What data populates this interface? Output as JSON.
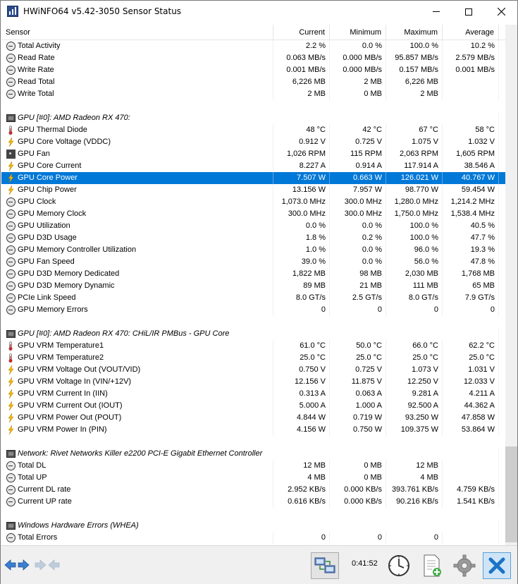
{
  "window": {
    "title": "HWiNFO64 v5.42-3050 Sensor Status"
  },
  "columns": {
    "sensor": "Sensor",
    "current": "Current",
    "minimum": "Minimum",
    "maximum": "Maximum",
    "average": "Average"
  },
  "rows": [
    {
      "type": "sensor",
      "icon": "clock-icon",
      "name": "Total Activity",
      "cur": "2.2 %",
      "min": "0.0 %",
      "max": "100.0 %",
      "avg": "10.2 %"
    },
    {
      "type": "sensor",
      "icon": "clock-icon",
      "name": "Read Rate",
      "cur": "0.063 MB/s",
      "min": "0.000 MB/s",
      "max": "95.857 MB/s",
      "avg": "2.579 MB/s"
    },
    {
      "type": "sensor",
      "icon": "clock-icon",
      "name": "Write Rate",
      "cur": "0.001 MB/s",
      "min": "0.000 MB/s",
      "max": "0.157 MB/s",
      "avg": "0.001 MB/s"
    },
    {
      "type": "sensor",
      "icon": "clock-icon",
      "name": "Read Total",
      "cur": "6,226 MB",
      "min": "2 MB",
      "max": "6,226 MB",
      "avg": ""
    },
    {
      "type": "sensor",
      "icon": "clock-icon",
      "name": "Write Total",
      "cur": "2 MB",
      "min": "0 MB",
      "max": "2 MB",
      "avg": ""
    },
    {
      "type": "blank"
    },
    {
      "type": "group",
      "icon": "chip-icon",
      "name": "GPU [#0]: AMD Radeon RX 470:"
    },
    {
      "type": "sensor",
      "icon": "thermometer-icon",
      "name": "GPU Thermal Diode",
      "cur": "48 °C",
      "min": "42 °C",
      "max": "67 °C",
      "avg": "58 °C"
    },
    {
      "type": "sensor",
      "icon": "bolt-icon",
      "name": "GPU Core Voltage (VDDC)",
      "cur": "0.912 V",
      "min": "0.725 V",
      "max": "1.075 V",
      "avg": "1.032 V"
    },
    {
      "type": "sensor",
      "icon": "fan-icon",
      "name": "GPU Fan",
      "cur": "1,026 RPM",
      "min": "115 RPM",
      "max": "2,063 RPM",
      "avg": "1,605 RPM"
    },
    {
      "type": "sensor",
      "icon": "bolt-icon",
      "name": "GPU Core Current",
      "cur": "8.227 A",
      "min": "0.914 A",
      "max": "117.914 A",
      "avg": "38.546 A"
    },
    {
      "type": "sensor",
      "icon": "bolt-icon",
      "name": "GPU Core Power",
      "cur": "7.507 W",
      "min": "0.663 W",
      "max": "126.021 W",
      "avg": "40.767 W",
      "selected": true
    },
    {
      "type": "sensor",
      "icon": "bolt-icon",
      "name": "GPU Chip Power",
      "cur": "13.156 W",
      "min": "7.957 W",
      "max": "98.770 W",
      "avg": "59.454 W"
    },
    {
      "type": "sensor",
      "icon": "clock-icon",
      "name": "GPU Clock",
      "cur": "1,073.0 MHz",
      "min": "300.0 MHz",
      "max": "1,280.0 MHz",
      "avg": "1,214.2 MHz"
    },
    {
      "type": "sensor",
      "icon": "clock-icon",
      "name": "GPU Memory Clock",
      "cur": "300.0 MHz",
      "min": "300.0 MHz",
      "max": "1,750.0 MHz",
      "avg": "1,538.4 MHz"
    },
    {
      "type": "sensor",
      "icon": "clock-icon",
      "name": "GPU Utilization",
      "cur": "0.0 %",
      "min": "0.0 %",
      "max": "100.0 %",
      "avg": "40.5 %"
    },
    {
      "type": "sensor",
      "icon": "clock-icon",
      "name": "GPU D3D Usage",
      "cur": "1.8 %",
      "min": "0.2 %",
      "max": "100.0 %",
      "avg": "47.7 %"
    },
    {
      "type": "sensor",
      "icon": "clock-icon",
      "name": "GPU Memory Controller Utilization",
      "cur": "1.0 %",
      "min": "0.0 %",
      "max": "96.0 %",
      "avg": "19.3 %"
    },
    {
      "type": "sensor",
      "icon": "clock-icon",
      "name": "GPU Fan Speed",
      "cur": "39.0 %",
      "min": "0.0 %",
      "max": "56.0 %",
      "avg": "47.8 %"
    },
    {
      "type": "sensor",
      "icon": "clock-icon",
      "name": "GPU D3D Memory Dedicated",
      "cur": "1,822 MB",
      "min": "98 MB",
      "max": "2,030 MB",
      "avg": "1,768 MB"
    },
    {
      "type": "sensor",
      "icon": "clock-icon",
      "name": "GPU D3D Memory Dynamic",
      "cur": "89 MB",
      "min": "21 MB",
      "max": "111 MB",
      "avg": "65 MB"
    },
    {
      "type": "sensor",
      "icon": "clock-icon",
      "name": "PCIe Link Speed",
      "cur": "8.0 GT/s",
      "min": "2.5 GT/s",
      "max": "8.0 GT/s",
      "avg": "7.9 GT/s"
    },
    {
      "type": "sensor",
      "icon": "clock-icon",
      "name": "GPU Memory Errors",
      "cur": "0",
      "min": "0",
      "max": "0",
      "avg": "0"
    },
    {
      "type": "blank"
    },
    {
      "type": "group",
      "icon": "chip-icon",
      "name": "GPU [#0]: AMD Radeon RX 470: CHiL/IR PMBus - GPU Core"
    },
    {
      "type": "sensor",
      "icon": "thermometer-icon",
      "name": "GPU VRM Temperature1",
      "cur": "61.0 °C",
      "min": "50.0 °C",
      "max": "66.0 °C",
      "avg": "62.2 °C"
    },
    {
      "type": "sensor",
      "icon": "thermometer-icon",
      "name": "GPU VRM Temperature2",
      "cur": "25.0 °C",
      "min": "25.0 °C",
      "max": "25.0 °C",
      "avg": "25.0 °C"
    },
    {
      "type": "sensor",
      "icon": "bolt-icon",
      "name": "GPU VRM Voltage Out (VOUT/VID)",
      "cur": "0.750 V",
      "min": "0.725 V",
      "max": "1.073 V",
      "avg": "1.031 V"
    },
    {
      "type": "sensor",
      "icon": "bolt-icon",
      "name": "GPU VRM Voltage In (VIN/+12V)",
      "cur": "12.156 V",
      "min": "11.875 V",
      "max": "12.250 V",
      "avg": "12.033 V"
    },
    {
      "type": "sensor",
      "icon": "bolt-icon",
      "name": "GPU VRM Current In (IIN)",
      "cur": "0.313 A",
      "min": "0.063 A",
      "max": "9.281 A",
      "avg": "4.211 A"
    },
    {
      "type": "sensor",
      "icon": "bolt-icon",
      "name": "GPU VRM Current Out (IOUT)",
      "cur": "5.000 A",
      "min": "1.000 A",
      "max": "92.500 A",
      "avg": "44.362 A"
    },
    {
      "type": "sensor",
      "icon": "bolt-icon",
      "name": "GPU VRM Power Out (POUT)",
      "cur": "4.844 W",
      "min": "0.719 W",
      "max": "93.250 W",
      "avg": "47.858 W"
    },
    {
      "type": "sensor",
      "icon": "bolt-icon",
      "name": "GPU VRM Power In (PIN)",
      "cur": "4.156 W",
      "min": "0.750 W",
      "max": "109.375 W",
      "avg": "53.864 W"
    },
    {
      "type": "blank"
    },
    {
      "type": "group",
      "icon": "chip-icon",
      "name": "Network: Rivet Networks Killer e2200 PCI-E Gigabit Ethernet Controller"
    },
    {
      "type": "sensor",
      "icon": "clock-icon",
      "name": "Total DL",
      "cur": "12 MB",
      "min": "0 MB",
      "max": "12 MB",
      "avg": ""
    },
    {
      "type": "sensor",
      "icon": "clock-icon",
      "name": "Total UP",
      "cur": "4 MB",
      "min": "0 MB",
      "max": "4 MB",
      "avg": ""
    },
    {
      "type": "sensor",
      "icon": "clock-icon",
      "name": "Current DL rate",
      "cur": "2.952 KB/s",
      "min": "0.000 KB/s",
      "max": "393.761 KB/s",
      "avg": "4.759 KB/s"
    },
    {
      "type": "sensor",
      "icon": "clock-icon",
      "name": "Current UP rate",
      "cur": "0.616 KB/s",
      "min": "0.000 KB/s",
      "max": "90.216 KB/s",
      "avg": "1.541 KB/s"
    },
    {
      "type": "blank"
    },
    {
      "type": "group",
      "icon": "chip-icon",
      "name": "Windows Hardware Errors (WHEA)"
    },
    {
      "type": "sensor",
      "icon": "clock-icon",
      "name": "Total Errors",
      "cur": "0",
      "min": "0",
      "max": "0",
      "avg": ""
    }
  ],
  "toolbar": {
    "timer": "0:41:52"
  },
  "colors": {
    "selection": "#0078d7",
    "bolt": "#f5b800",
    "close_accent": "#1a73c7"
  }
}
